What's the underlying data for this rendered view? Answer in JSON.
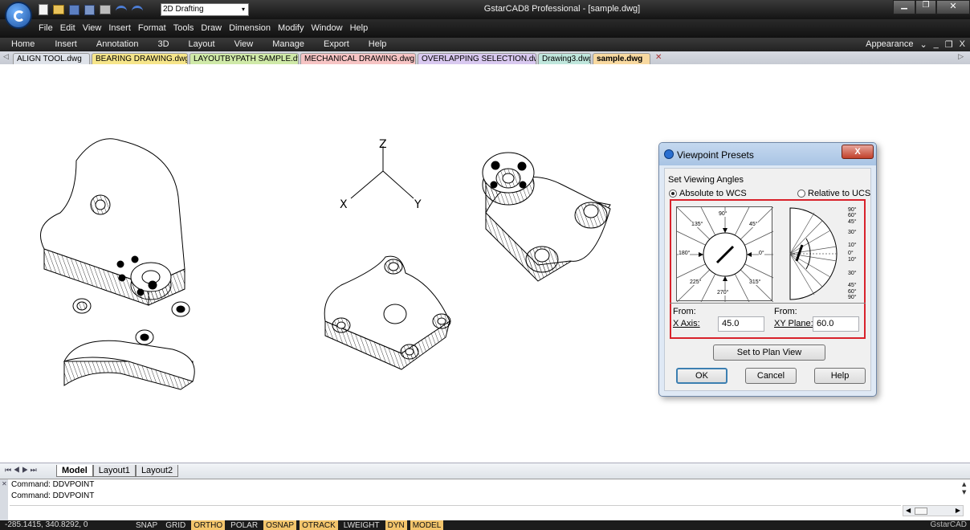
{
  "app": {
    "workspace": "2D Drafting",
    "window_title": "GstarCAD8 Professional - [sample.dwg]"
  },
  "menu": [
    "File",
    "Edit",
    "View",
    "Insert",
    "Format",
    "Tools",
    "Draw",
    "Dimension",
    "Modify",
    "Window",
    "Help"
  ],
  "ribbon_tabs": [
    "Home",
    "Insert",
    "Annotation",
    "3D",
    "Layout",
    "View",
    "Manage",
    "Export",
    "Help"
  ],
  "ribbon_right": "Appearance",
  "doc_tabs": [
    {
      "label": "ALIGN TOOL.dwg",
      "color": "#dfe3ea"
    },
    {
      "label": "BEARING DRAWING.dwg",
      "color": "#f6e58a"
    },
    {
      "label": "LAYOUTBYPATH SAMPLE.dwg",
      "color": "#cfe9a8"
    },
    {
      "label": "MECHANICAL DRAWING.dwg",
      "color": "#f6c4c4"
    },
    {
      "label": "OVERLAPPING SELECTION.dwg",
      "color": "#d9c9f0"
    },
    {
      "label": "Drawing3.dwg",
      "color": "#bfe6dc"
    },
    {
      "label": "sample.dwg",
      "color": "#f8d9a0"
    }
  ],
  "ucs": {
    "z": "Z",
    "x": "X",
    "y": "Y"
  },
  "layout_tabs": [
    "Model",
    "Layout1",
    "Layout2"
  ],
  "command_lines": [
    "Command: DDVPOINT",
    "Command: DDVPOINT"
  ],
  "coordinates": "-285.1415, 340.8292, 0",
  "status_toggles": [
    {
      "label": "SNAP",
      "on": false
    },
    {
      "label": "GRID",
      "on": false
    },
    {
      "label": "ORTHO",
      "on": true
    },
    {
      "label": "POLAR",
      "on": false
    },
    {
      "label": "OSNAP",
      "on": true
    },
    {
      "label": "OTRACK",
      "on": true
    },
    {
      "label": "LWEIGHT",
      "on": false
    },
    {
      "label": "DYN",
      "on": true
    },
    {
      "label": "MODEL",
      "on": true
    }
  ],
  "status_brand": "GstarCAD",
  "dialog": {
    "title": "Viewpoint Presets",
    "group_label": "Set Viewing Angles",
    "radio_absolute": "Absolute to WCS",
    "radio_relative": "Relative to UCS",
    "compass_labels": [
      "90°",
      "135°",
      "45°",
      "180°",
      "0°",
      "225°",
      "270°",
      "315°"
    ],
    "plane_labels": [
      "90°",
      "60°",
      "45°",
      "30°",
      "10°",
      "0°",
      "10°",
      "30°",
      "45°",
      "60°",
      "90°"
    ],
    "from_label": "From:",
    "x_axis_label": "X Axis:",
    "xy_plane_label": "XY Plane:",
    "x_axis_value": "45.0",
    "xy_plane_value": "60.0",
    "set_plan_view": "Set to Plan View",
    "ok": "OK",
    "cancel": "Cancel",
    "help": "Help"
  }
}
